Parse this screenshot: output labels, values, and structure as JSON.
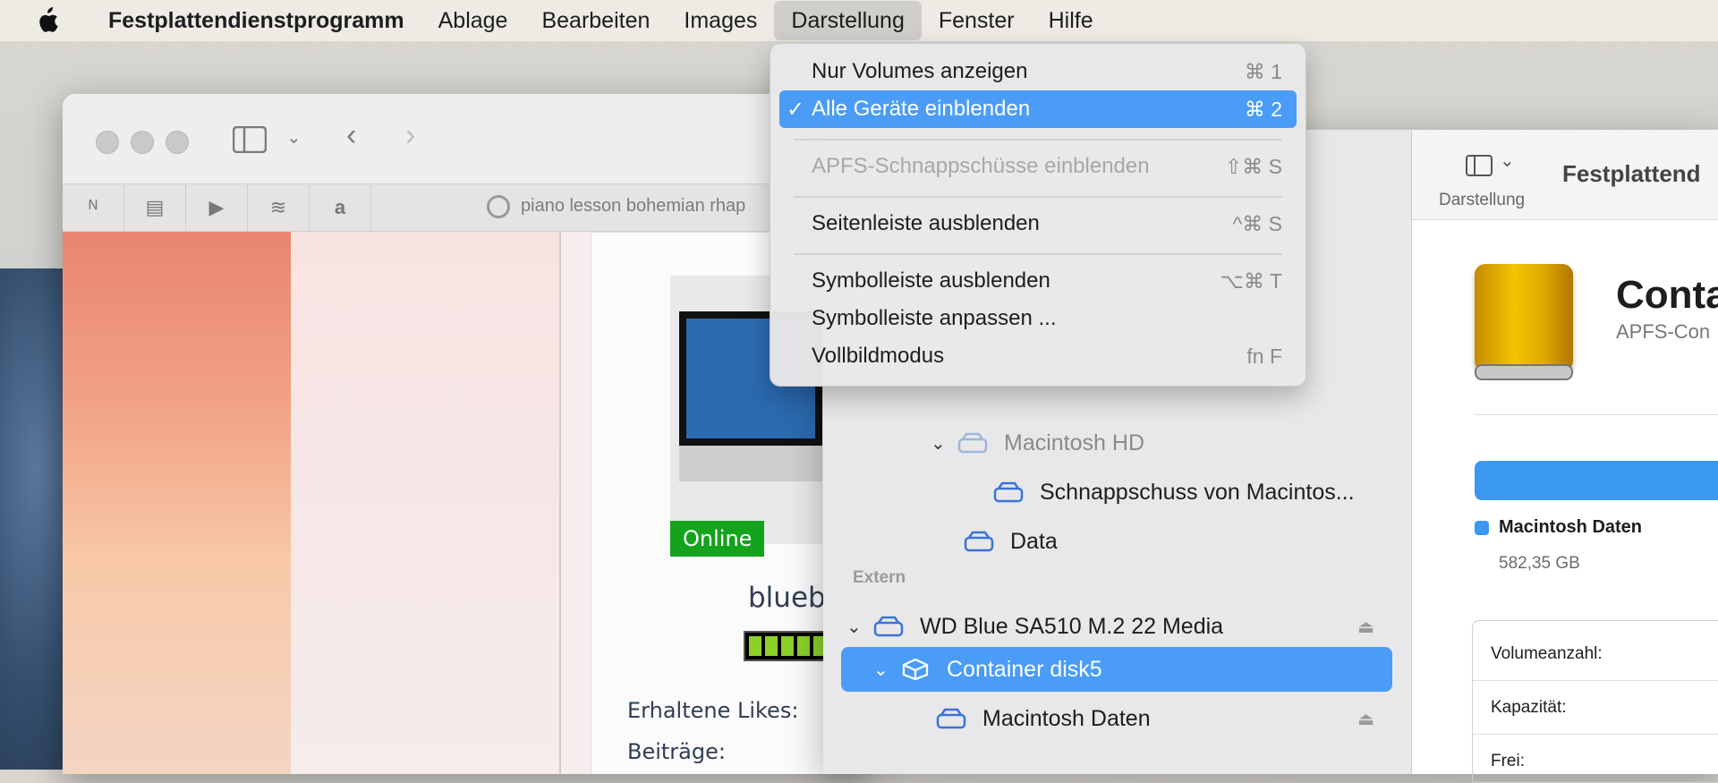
{
  "menubar": {
    "app": "Festplattendienstprogramm",
    "items": [
      "Ablage",
      "Bearbeiten",
      "Images",
      "Darstellung",
      "Fenster",
      "Hilfe"
    ]
  },
  "view_menu": {
    "items": [
      {
        "label": "Nur Volumes anzeigen",
        "shortcut": "⌘ 1"
      },
      {
        "label": "Alle Geräte einblenden",
        "shortcut": "⌘ 2",
        "checked": "✓"
      },
      {
        "label": "APFS-Schnappschüsse einblenden",
        "shortcut": "⇧⌘ S"
      },
      {
        "label": "Seitenleiste ausblenden",
        "shortcut": "^⌘ S"
      },
      {
        "label": "Symbolleiste ausblenden",
        "shortcut": "⌥⌘ T"
      },
      {
        "label": "Symbolleiste anpassen ...",
        "shortcut": ""
      },
      {
        "label": "Vollbildmodus",
        "shortcut": "fn F"
      }
    ]
  },
  "browser": {
    "tab_text": "piano lesson bohemian rhap",
    "online_badge": "Online",
    "username": "blueby",
    "stats": [
      "Erhaltene Likes:",
      "Beiträge:"
    ]
  },
  "disk_utility": {
    "toolbar": {
      "view_label": "Darstellung",
      "title": "Festplattend"
    },
    "tree": {
      "macintosh_hd": "Macintosh HD",
      "snapshot": "Schnappschuss von Macintos...",
      "data": "Data",
      "section_external": "Extern",
      "wd_drive": "WD Blue SA510 M.2 22 Media",
      "container": "Container disk5",
      "mac_daten": "Macintosh Daten"
    },
    "detail": {
      "title": "Conta",
      "subtitle": "APFS-Con",
      "legend_name": "Macintosh Daten",
      "legend_size": "582,35 GB",
      "info_labels": [
        "Volumeanzahl:",
        "Kapazität:",
        "Frei:"
      ]
    }
  },
  "colors": {
    "accent": "#4a9cf6",
    "online": "#14a31d",
    "disk": "#f4c400"
  }
}
